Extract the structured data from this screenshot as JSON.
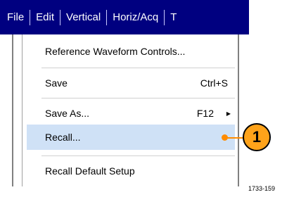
{
  "menubar": {
    "items": [
      "File",
      "Edit",
      "Vertical",
      "Horiz/Acq",
      "T"
    ]
  },
  "menu": {
    "items": [
      {
        "label": "Reference Waveform Controls...",
        "shortcut": ""
      },
      {
        "label": "Save",
        "shortcut": "Ctrl+S"
      },
      {
        "label": "Save As...",
        "shortcut": "F12"
      },
      {
        "label": "Recall...",
        "shortcut": ""
      },
      {
        "label": "Recall Default Setup",
        "shortcut": ""
      }
    ],
    "submenu_arrow": "▶"
  },
  "callout": {
    "number": "1"
  },
  "figure_id": "1733-159",
  "colors": {
    "menubar_bg": "#000080",
    "highlight": "#cfe1f6",
    "callout": "#ffa31a"
  }
}
